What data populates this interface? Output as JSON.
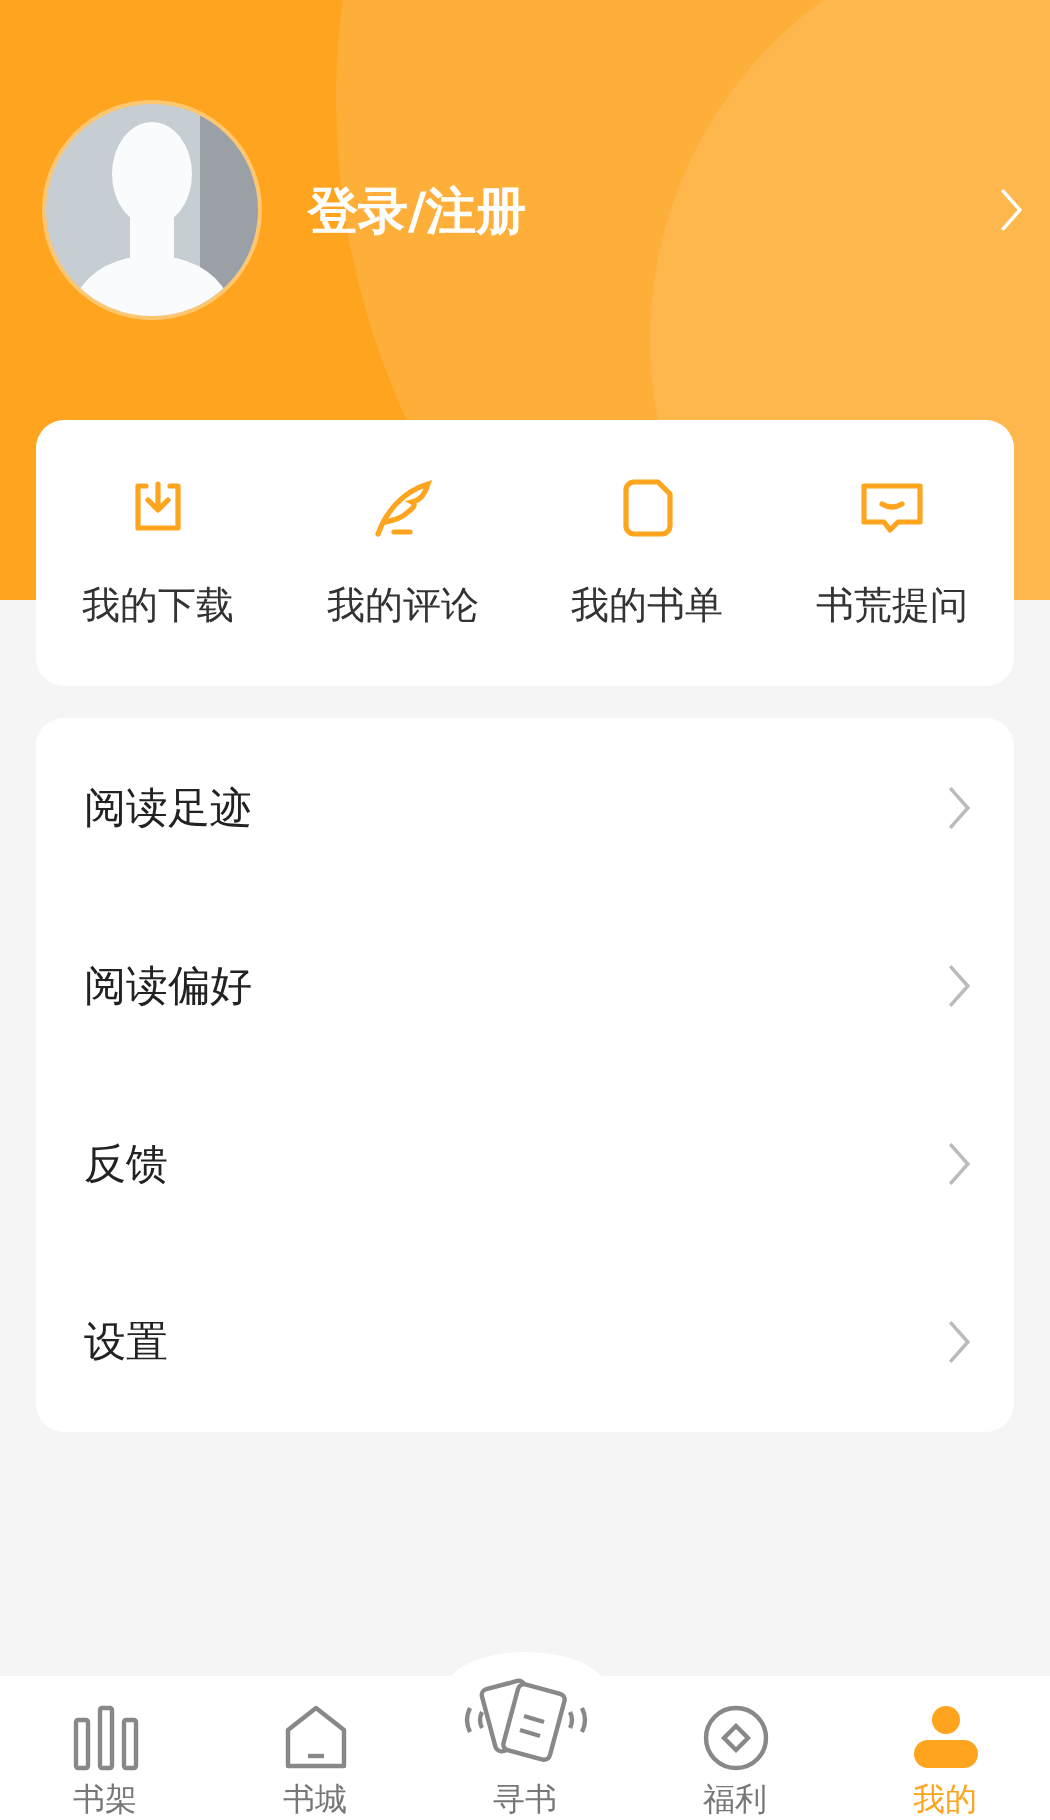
{
  "profile": {
    "login_label": "登录/注册"
  },
  "quick_actions": [
    {
      "label": "我的下载"
    },
    {
      "label": "我的评论"
    },
    {
      "label": "我的书单"
    },
    {
      "label": "书荒提问"
    }
  ],
  "menu": [
    {
      "label": "阅读足迹"
    },
    {
      "label": "阅读偏好"
    },
    {
      "label": "反馈"
    },
    {
      "label": "设置"
    }
  ],
  "tabs": [
    {
      "label": "书架",
      "selected": false
    },
    {
      "label": "书城",
      "selected": false
    },
    {
      "label": "寻书",
      "selected": false
    },
    {
      "label": "福利",
      "selected": false
    },
    {
      "label": "我的",
      "selected": true
    }
  ]
}
